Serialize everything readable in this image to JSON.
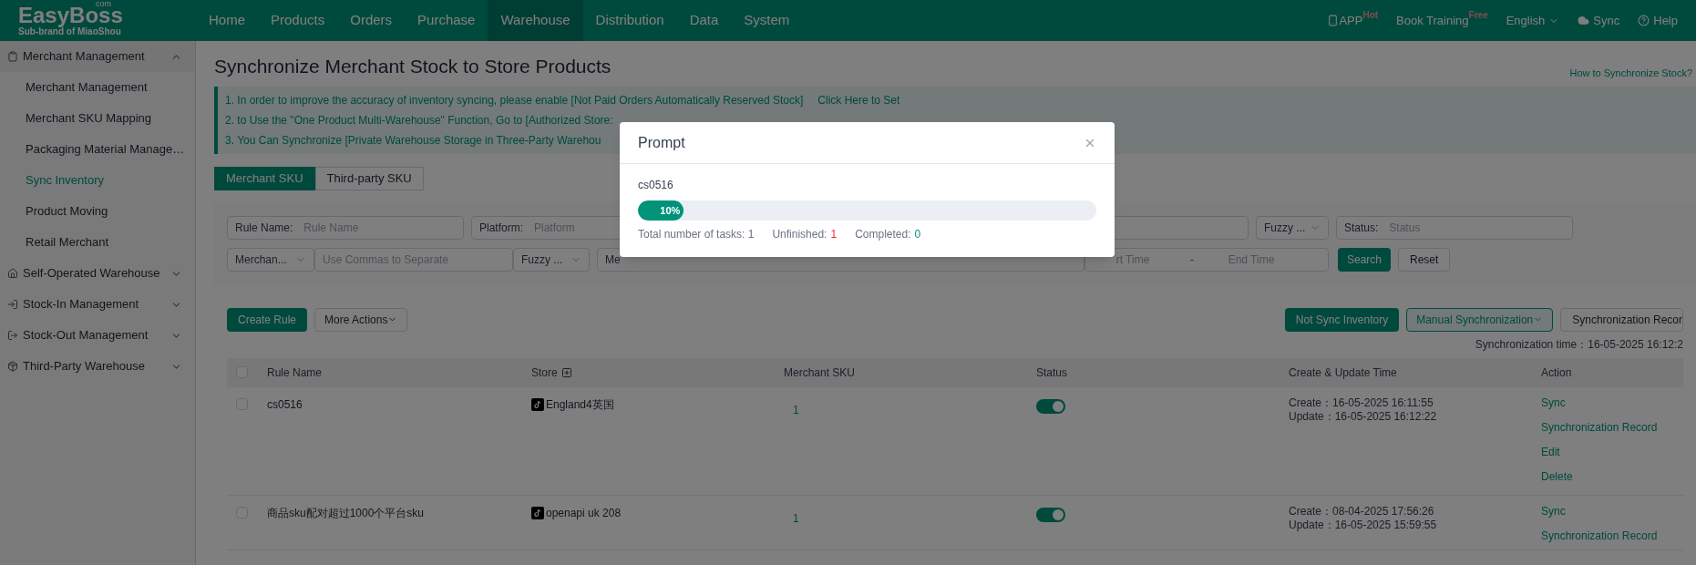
{
  "logo": {
    "name": "EasyBoss",
    "suffix": "com",
    "tagline": "Sub-brand of MiaoShou"
  },
  "nav": [
    {
      "label": "Home",
      "selected": false
    },
    {
      "label": "Products",
      "selected": false
    },
    {
      "label": "Orders",
      "selected": false
    },
    {
      "label": "Purchase",
      "selected": false
    },
    {
      "label": "Warehouse",
      "selected": true
    },
    {
      "label": "Distribution",
      "selected": false
    },
    {
      "label": "Data",
      "selected": false
    },
    {
      "label": "System",
      "selected": false
    }
  ],
  "nav_right": {
    "app": "APP",
    "app_badge": "Hot",
    "training": "Book Training",
    "training_badge": "Free",
    "language": "English",
    "sync": "Sync",
    "help": "Help"
  },
  "sidebar": [
    {
      "label": "Merchant Management",
      "expanded": true,
      "children": [
        {
          "label": "Merchant Management",
          "selected": false
        },
        {
          "label": "Merchant SKU Mapping",
          "selected": false
        },
        {
          "label": "Packaging Material Manage…",
          "selected": false
        },
        {
          "label": "Sync Inventory",
          "selected": true
        },
        {
          "label": "Product Moving",
          "selected": false
        },
        {
          "label": "Retail Merchant",
          "selected": false
        }
      ]
    },
    {
      "label": "Self-Operated Warehouse",
      "expanded": false
    },
    {
      "label": "Stock-In Management",
      "expanded": false
    },
    {
      "label": "Stock-Out Management",
      "expanded": false
    },
    {
      "label": "Third-Party Warehouse",
      "expanded": false
    }
  ],
  "page_title": "Synchronize Merchant Stock to Store Products",
  "help_link": "How to Synchronize Stock?",
  "notices": [
    {
      "text": "1. In order to improve the accuracy of inventory syncing, please enable [Not Paid Orders Automatically Reserved Stock]",
      "link": "Click Here to Set"
    },
    {
      "text": "2. to Use the \"One Product Multi-Warehouse\" Function, Go to [Authorized Store:"
    },
    {
      "text": "3. You Can Synchronize [Private Warehouse Storage in Three-Party Warehou"
    }
  ],
  "tabs": [
    {
      "label": "Merchant SKU",
      "selected": true
    },
    {
      "label": "Third-party SKU",
      "selected": false
    }
  ],
  "filters": {
    "rule_name": {
      "label": "Rule Name:",
      "placeholder": "Rule Name"
    },
    "platform": {
      "label": "Platform:",
      "placeholder": "Platform"
    },
    "fuzzy_1": "Fuzzy ...",
    "status": {
      "label": "Status:",
      "placeholder": "Status"
    },
    "merchant_select": "Merchan...",
    "merchant_input": {
      "placeholder": "Use Commas to Separate"
    },
    "fuzzy_2": "Fuzzy ...",
    "me_select": "Me",
    "start_time": {
      "placeholder": "rt Time"
    },
    "time_separator": "-",
    "end_time": {
      "placeholder": "End Time"
    },
    "search": "Search",
    "reset": "Reset"
  },
  "toolbar": {
    "create": "Create Rule",
    "more": "More Actions",
    "not_sync": "Not Sync Inventory",
    "manual": "Manual Synchronization",
    "record": "Synchronization Recor",
    "sync_time": "Synchronization time：16-05-2025 16:12:2"
  },
  "table": {
    "all_checked": false,
    "columns": [
      "Rule Name",
      "Store",
      "Merchant SKU",
      "Status",
      "Create & Update Time",
      "Action"
    ],
    "rows": [
      {
        "checked": false,
        "rule_name": "cs0516",
        "store": "England4英国",
        "merchant_sku": "1",
        "on": true,
        "create": "Create：16-05-2025 16:11:55",
        "update": "Update：16-05-2025 16:12:22",
        "actions": [
          "Sync",
          "Synchronization Record",
          "Edit",
          "Delete"
        ]
      },
      {
        "checked": false,
        "rule_name": "商品sku配对超过1000个平台sku",
        "store": "openapi uk 208",
        "merchant_sku": "1",
        "on": true,
        "create": "Create：08-04-2025 17:56:26",
        "update": "Update：16-05-2025 15:59:55",
        "actions": [
          "Sync",
          "Synchronization Record"
        ]
      }
    ]
  },
  "modal": {
    "title": "Prompt",
    "task": "cs0516",
    "level": 0.1,
    "percent": "10%",
    "total": "Total number of tasks: 1",
    "unfinished_label": "Unfinished:",
    "unfinished": "1",
    "completed_label": "Completed:",
    "completed": "0"
  }
}
